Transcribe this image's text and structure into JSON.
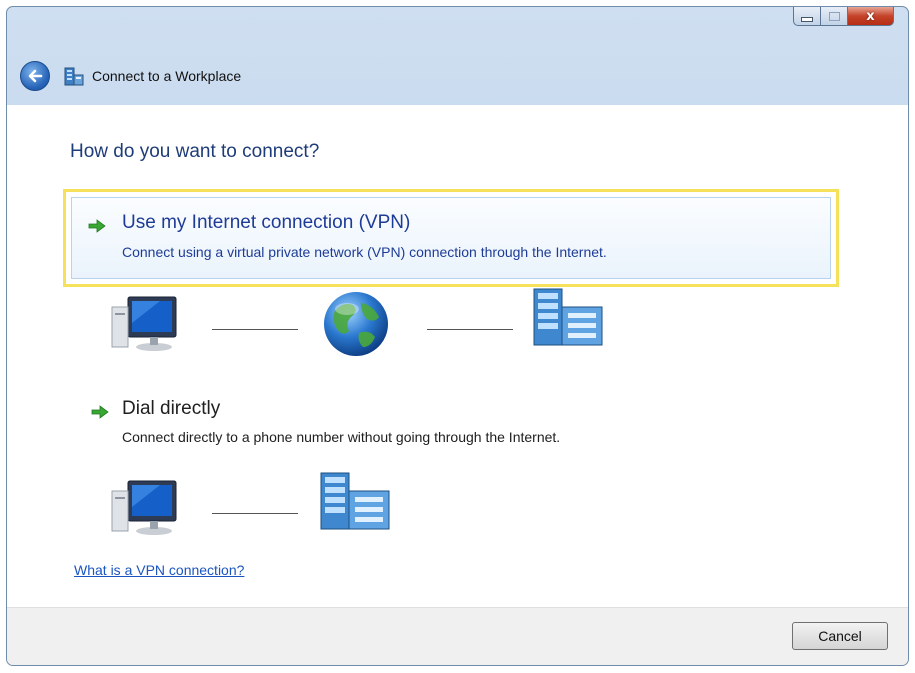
{
  "window": {
    "title": "Connect to a Workplace",
    "controls": {
      "minimize": "minimize-icon",
      "maximize": "maximize-icon",
      "close_label": "x"
    }
  },
  "page": {
    "question": "How do you want to connect?"
  },
  "options": [
    {
      "title": "Use my Internet connection (VPN)",
      "description": "Connect using a virtual private network (VPN) connection through the Internet.",
      "highlighted": true,
      "illustration": [
        "computer-icon",
        "globe-icon",
        "workplace-server-icon"
      ]
    },
    {
      "title": "Dial directly",
      "description": "Connect directly to a phone number without going through the Internet.",
      "highlighted": false,
      "illustration": [
        "computer-icon",
        "workplace-server-icon"
      ]
    }
  ],
  "help_link": "What is a VPN connection?",
  "footer": {
    "cancel_label": "Cancel"
  },
  "colors": {
    "highlight_border": "#f6e25a",
    "link": "#1a55c0",
    "heading": "#1e3c78",
    "option_blue": "#1e3c96"
  }
}
